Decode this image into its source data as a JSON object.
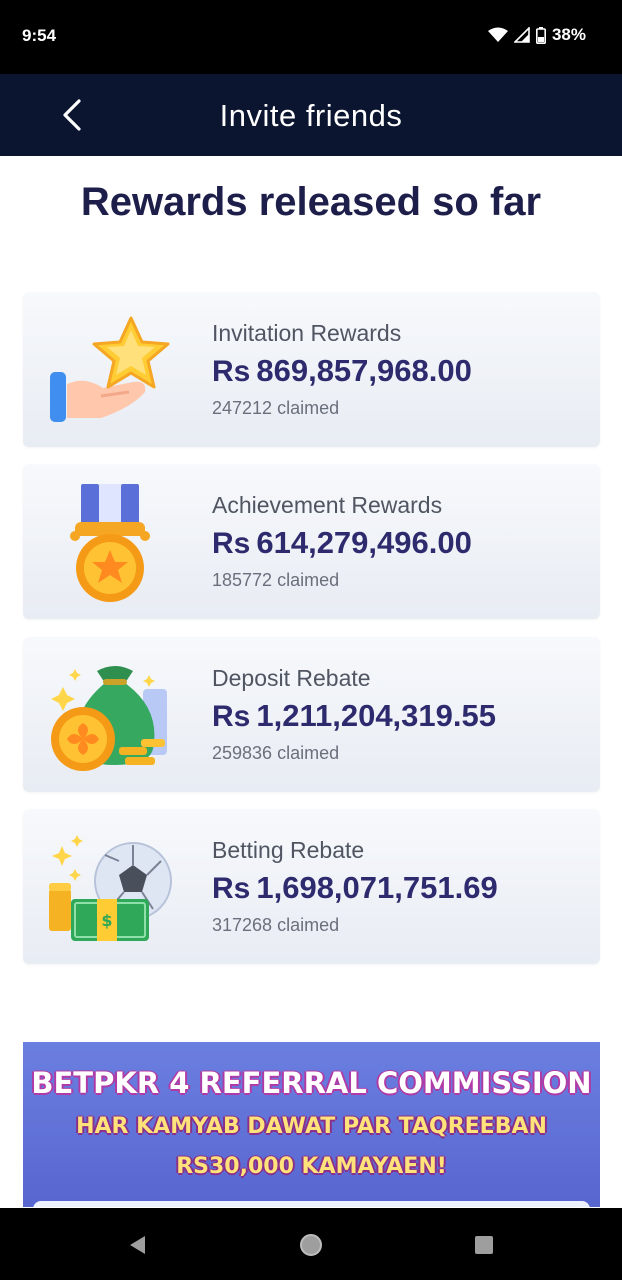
{
  "status_bar": {
    "time": "9:54",
    "battery": "38%"
  },
  "header": {
    "title": "Invite friends"
  },
  "heading": "Rewards released so far",
  "cards": [
    {
      "icon": "hand-star-icon",
      "title": "Invitation Rewards",
      "currency": "Rs",
      "amount": "869,857,968.00",
      "claimed": "247212 claimed"
    },
    {
      "icon": "medal-icon",
      "title": "Achievement Rewards",
      "currency": "Rs",
      "amount": "614,279,496.00",
      "claimed": "185772 claimed"
    },
    {
      "icon": "money-bag-icon",
      "title": "Deposit Rebate",
      "currency": "Rs",
      "amount": "1,211,204,319.55",
      "claimed": "259836 claimed"
    },
    {
      "icon": "football-cash-icon",
      "title": "Betting Rebate",
      "currency": "Rs",
      "amount": "1,698,071,751.69",
      "claimed": "317268 claimed"
    }
  ],
  "banner": {
    "line1": "BETPKR 4 REFERRAL COMMISSION",
    "line2": "HAR KAMYAB DAWAT PAR TAQREEBAN",
    "line3": "RS30,000 KAMAYAEN!"
  },
  "colors": {
    "header_bg": "#0c1530",
    "heading_text": "#1e1e4a",
    "amount_text": "#2e2a6e",
    "banner_bg": "#6b7fe0"
  }
}
